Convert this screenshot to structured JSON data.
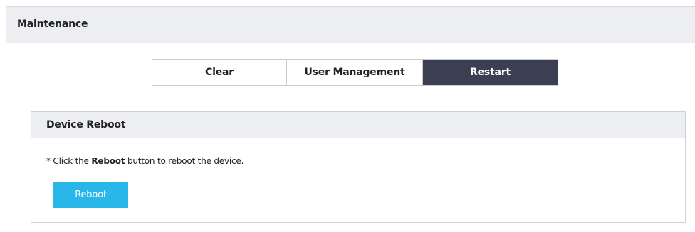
{
  "header": {
    "title": "Maintenance"
  },
  "tabs": [
    {
      "label": "Clear",
      "active": false
    },
    {
      "label": "User Management",
      "active": false
    },
    {
      "label": "Restart",
      "active": true
    }
  ],
  "panel": {
    "title": "Device Reboot",
    "note_prefix": "* Click the ",
    "note_bold": "Reboot",
    "note_suffix": " button to reboot the device.",
    "button_label": "Reboot"
  },
  "colors": {
    "active_tab": "#3b3f51",
    "button": "#29b6e8",
    "header_bg": "#eceef1"
  }
}
